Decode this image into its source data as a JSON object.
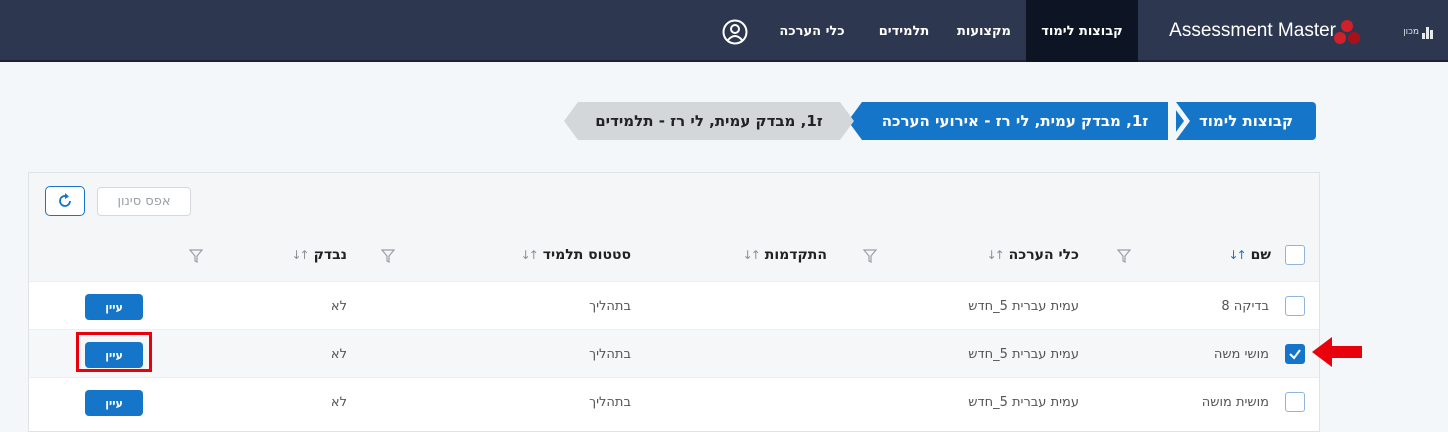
{
  "header": {
    "logo_text": "מכון",
    "app_title": "Assessment Master",
    "nav": [
      {
        "label": "קבוצות לימוד",
        "active": true
      },
      {
        "label": "מקצועות",
        "active": false
      },
      {
        "label": "תלמידים",
        "active": false
      },
      {
        "label": "כלי הערכה",
        "active": false
      }
    ],
    "user_icon": "user-circle-icon"
  },
  "breadcrumb": [
    {
      "label": "קבוצות לימוד",
      "style": "blue"
    },
    {
      "label": "ז1, מבדק עמית, לי רז - אירועי הערכה",
      "style": "blue"
    },
    {
      "label": "ז1, מבדק עמית, לי רז - תלמידים",
      "style": "gray"
    }
  ],
  "toolbar": {
    "reset_filter_label": "אפס סינון",
    "refresh_icon": "refresh-icon"
  },
  "table": {
    "columns": [
      {
        "label": "שם",
        "sort_icon": "sort-ascending-icon"
      },
      {
        "label": "כלי הערכה",
        "sort_icon": "sort-icon"
      },
      {
        "label": "התקדמות",
        "sort_icon": "sort-icon"
      },
      {
        "label": "סטטוס תלמיד",
        "sort_icon": "sort-icon"
      },
      {
        "label": "נבדק",
        "sort_icon": "sort-icon"
      }
    ],
    "filter_icon": "filter-icon",
    "rows": [
      {
        "checked": false,
        "name": "בדיקה 8",
        "tool": "עמית עברית 5_חדש",
        "progress": "",
        "status": "בתהליך",
        "checked_out": "לא",
        "action": "עיין"
      },
      {
        "checked": true,
        "name": "מושי משה",
        "tool": "עמית עברית 5_חדש",
        "progress": "",
        "status": "בתהליך",
        "checked_out": "לא",
        "action": "עיין"
      },
      {
        "checked": false,
        "name": "מושית מושה",
        "tool": "עמית עברית 5_חדש",
        "progress": "",
        "status": "בתהליך",
        "checked_out": "לא",
        "action": "עיין"
      }
    ]
  },
  "annotations": {
    "highlight_color": "#e8000d",
    "arrow_icon": "arrow-left-icon"
  },
  "colors": {
    "nav_bg": "#2d3850",
    "nav_active": "#0d1423",
    "accent": "#1576c9"
  }
}
